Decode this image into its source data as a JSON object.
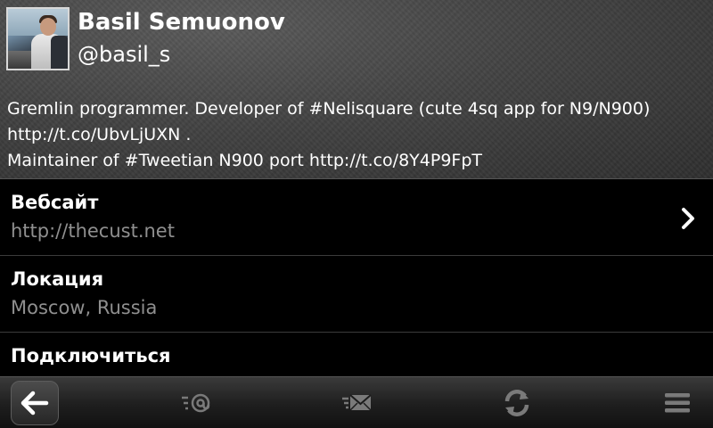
{
  "profile": {
    "display_name": "Basil Semuonov",
    "username": "@basil_s",
    "bio_lines": [
      "Gremlin programmer. Developer of #Nelisquare (cute 4sq app for N9/N900)",
      "http://t.co/UbvLjUXN .",
      "Maintainer of #Tweetian N900 port http://t.co/8Y4P9FpT"
    ]
  },
  "rows": [
    {
      "title": "Вебсайт",
      "value": "http://thecust.net",
      "has_chevron": true
    },
    {
      "title": "Локация",
      "value": "Moscow, Russia",
      "has_chevron": false
    },
    {
      "title": "Подключиться",
      "value": "",
      "has_chevron": false
    }
  ],
  "toolbar": {
    "items": [
      {
        "icon": "back-arrow-icon"
      },
      {
        "icon": "mentions-icon"
      },
      {
        "icon": "direct-messages-icon"
      },
      {
        "icon": "refresh-icon"
      },
      {
        "icon": "menu-icon"
      }
    ]
  },
  "colors": {
    "background": "#000000",
    "header": "#434343",
    "secondary_text": "#8f8f8f",
    "icon_gray": "#7a7a7a"
  }
}
